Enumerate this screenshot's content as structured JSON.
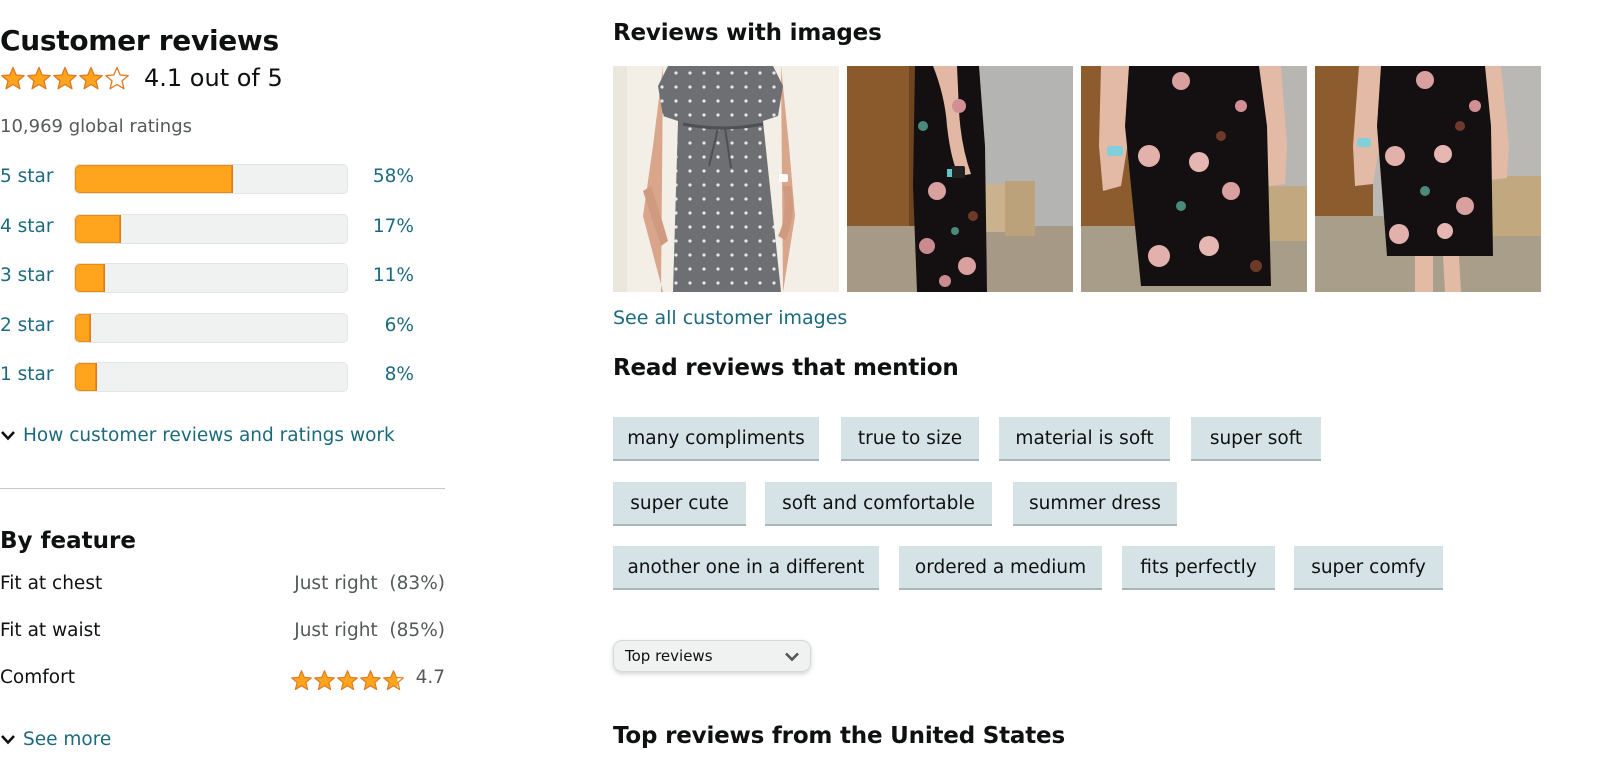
{
  "summary": {
    "title": "Customer reviews",
    "rating_value": 4.1,
    "rating_text": "4.1 out of 5",
    "global_ratings": "10,969 global ratings",
    "star_color": "#ffa41c"
  },
  "histogram": [
    {
      "label": "5 star",
      "percent": 58,
      "percent_text": "58%"
    },
    {
      "label": "4 star",
      "percent": 17,
      "percent_text": "17%"
    },
    {
      "label": "3 star",
      "percent": 11,
      "percent_text": "11%"
    },
    {
      "label": "2 star",
      "percent": 6,
      "percent_text": "6%"
    },
    {
      "label": "1 star",
      "percent": 8,
      "percent_text": "8%"
    }
  ],
  "how_link": "How customer reviews and ratings work",
  "by_feature": {
    "title": "By feature",
    "items": [
      {
        "name": "Fit at chest",
        "value": "Just right  (83%)"
      },
      {
        "name": "Fit at waist",
        "value": "Just right  (85%)"
      },
      {
        "name": "Comfort",
        "rating": 4.7,
        "value": "4.7"
      }
    ],
    "see_more": "See more"
  },
  "images_section": {
    "title": "Reviews with images",
    "images": [
      {
        "icon": "review-photo-grey-polka-dot-dress"
      },
      {
        "icon": "review-photo-floral-dress-side"
      },
      {
        "icon": "review-photo-floral-dress-front"
      },
      {
        "icon": "review-photo-floral-dress-front-2"
      }
    ],
    "see_all": "See all customer images"
  },
  "mentions": {
    "title": "Read reviews that mention",
    "chips": [
      "many compliments",
      "true to size",
      "material is soft",
      "super soft",
      "super cute",
      "soft and comfortable",
      "summer dress",
      "another one in a different",
      "ordered a medium",
      "fits perfectly",
      "super comfy"
    ]
  },
  "sort": {
    "selected": "Top reviews"
  },
  "top_reviews_title": "Top reviews from the United States"
}
